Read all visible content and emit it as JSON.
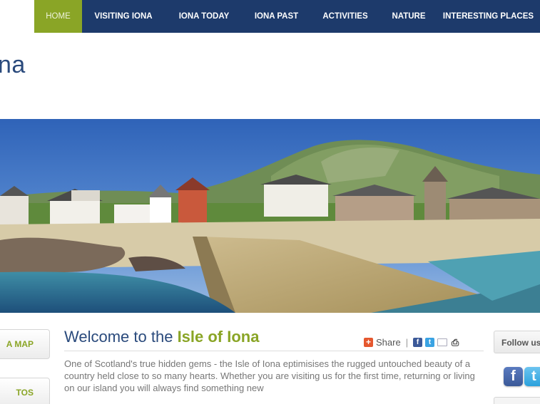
{
  "nav": {
    "items": [
      {
        "label": "HOME",
        "active": true
      },
      {
        "label": "VISITING IONA",
        "active": false
      },
      {
        "label": "IONA TODAY",
        "active": false
      },
      {
        "label": "IONA PAST",
        "active": false
      },
      {
        "label": "ACTIVITIES",
        "active": false
      },
      {
        "label": "NATURE",
        "active": false
      },
      {
        "label": "INTERESTING PLACES",
        "active": false
      }
    ]
  },
  "site": {
    "title": "na"
  },
  "colors": {
    "nav_bg": "#1d3a6b",
    "nav_active": "#8aa526",
    "accent_green": "#8aa526",
    "heading_blue": "#2a4a7c"
  },
  "sidebar_left": {
    "button_1": "A MAP",
    "button_2": "TOS"
  },
  "content": {
    "heading_prefix": "Welcome to the ",
    "heading_highlight": "Isle of Iona",
    "share_label": "Share",
    "share_separator": "|",
    "intro_text": "One of Scotland's true hidden gems - the Isle of Iona eptimisises the rugged untouched beauty of a country held close to so many hearts. Whether you are visiting us for the first time, returning or living on our island you will always find something new"
  },
  "share_icons": [
    "facebook-icon",
    "twitter-icon",
    "email-icon",
    "print-icon"
  ],
  "sidebar_right": {
    "follow_label": "Follow us",
    "icons": [
      "facebook-icon",
      "twitter-icon"
    ]
  }
}
